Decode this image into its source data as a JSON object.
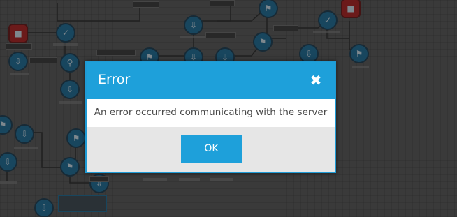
{
  "dialog": {
    "title": "Error",
    "close_icon": "close-icon",
    "message": "An error occurred communicating with the server",
    "ok_label": "OK"
  },
  "colors": {
    "accent": "#1ea0da",
    "dialog_body": "#ffffff",
    "dialog_footer": "#e6e6e6",
    "message_text": "#4a4a4a",
    "stop_node": "#b32020",
    "workflow_node": "#1d6f9c"
  }
}
